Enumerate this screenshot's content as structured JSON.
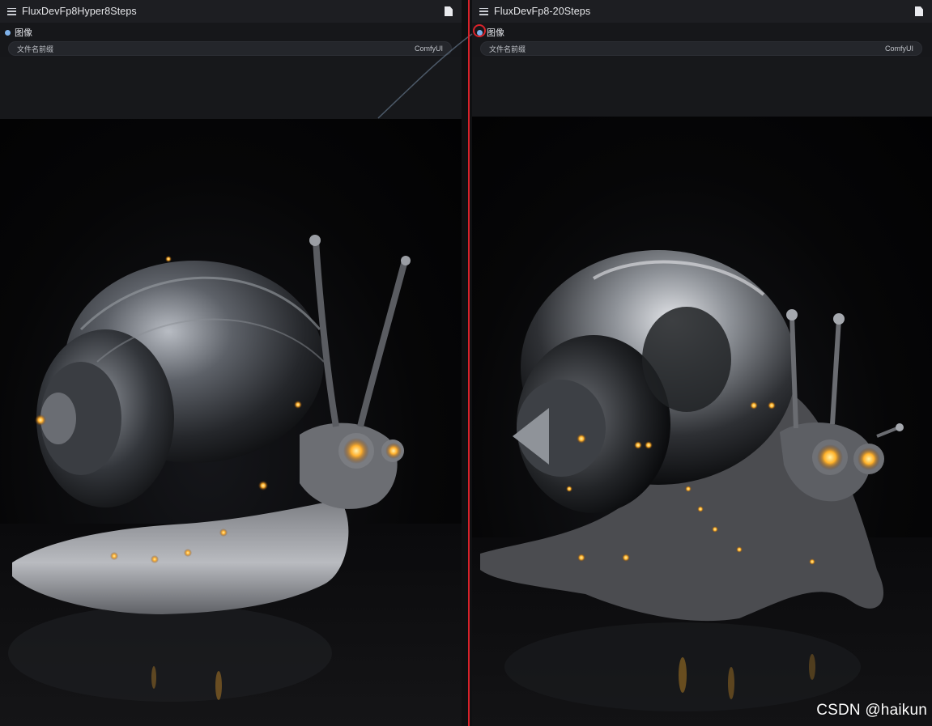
{
  "nodes": [
    {
      "title": "FluxDevFp8Hyper8Steps",
      "output_label": "图像",
      "widget": {
        "label": "文件名前缀",
        "value": "ComfyUI"
      }
    },
    {
      "title": "FluxDevFp8-20Steps",
      "output_label": "图像",
      "widget": {
        "label": "文件名前缀",
        "value": "ComfyUI"
      }
    }
  ],
  "icons": {
    "menu": "hamburger-menu-icon",
    "document": "document-icon",
    "output_slot": "output-dot-icon"
  },
  "colors": {
    "highlight_red": "#d8222a",
    "output_dot": "#7fb2ea",
    "glow_orange": "#ffb02e"
  },
  "watermark": "CSDN @haikun"
}
